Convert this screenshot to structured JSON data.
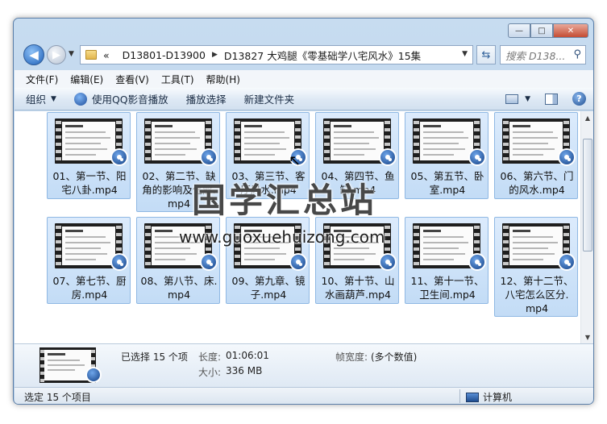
{
  "window": {
    "caption": {
      "minimize": "—",
      "maximize": "□",
      "close": "✕"
    }
  },
  "nav": {
    "back_glyph": "◀",
    "forward_glyph": "▶",
    "breadcrumbs": [
      "«",
      "D13801-D13900",
      "D13827 大鸡腿《零基础学八宅风水》15集"
    ],
    "search_placeholder": "搜索 D138...",
    "refresh_glyph": "⇆",
    "search_glyph": "⚲"
  },
  "menubar": {
    "items": [
      "文件(F)",
      "编辑(E)",
      "查看(V)",
      "工具(T)",
      "帮助(H)"
    ]
  },
  "cmdbar": {
    "organize": "组织",
    "play_qq": "使用QQ影音播放",
    "play_selection": "播放选择",
    "new_folder": "新建文件夹",
    "help_glyph": "?"
  },
  "files": [
    {
      "line1": "01、第一节、阳",
      "line2": "宅八卦.mp4",
      "line3": ""
    },
    {
      "line1": "02、第二节、缺",
      "line2": "角的影响及化解.",
      "line3": "mp4"
    },
    {
      "line1": "03、第三节、客",
      "line2": "厅风水.mp4",
      "line3": ""
    },
    {
      "line1": "04、第四节、鱼",
      "line2": "缸.mp4",
      "line3": ""
    },
    {
      "line1": "05、第五节、卧",
      "line2": "室.mp4",
      "line3": ""
    },
    {
      "line1": "06、第六节、门",
      "line2": "的风水.mp4",
      "line3": ""
    },
    {
      "line1": "07、第七节、厨",
      "line2": "房.mp4",
      "line3": ""
    },
    {
      "line1": "08、第八节、床.",
      "line2": "mp4",
      "line3": ""
    },
    {
      "line1": "09、第九章、镜",
      "line2": "子.mp4",
      "line3": ""
    },
    {
      "line1": "10、第十节、山",
      "line2": "水画葫芦.mp4",
      "line3": ""
    },
    {
      "line1": "11、第十一节、",
      "line2": "卫生间.mp4",
      "line3": ""
    },
    {
      "line1": "12、第十二节、",
      "line2": "八宅怎么区分.",
      "line3": "mp4"
    }
  ],
  "watermark": {
    "zh": "国学汇总站",
    "url": "www.guoxuehuizong.com"
  },
  "details": {
    "selected": "已选择 15 个项",
    "length_label": "长度:",
    "length_value": "01:06:01",
    "size_label": "大小:",
    "size_value": "336 MB",
    "framewidth_label": "帧宽度:",
    "framewidth_value": "(多个数值)"
  },
  "status": {
    "left": "选定 15 个项目",
    "right": "计算机"
  },
  "colors": {
    "accent": "#1e4d9a",
    "selection": "#c3dcf6"
  }
}
